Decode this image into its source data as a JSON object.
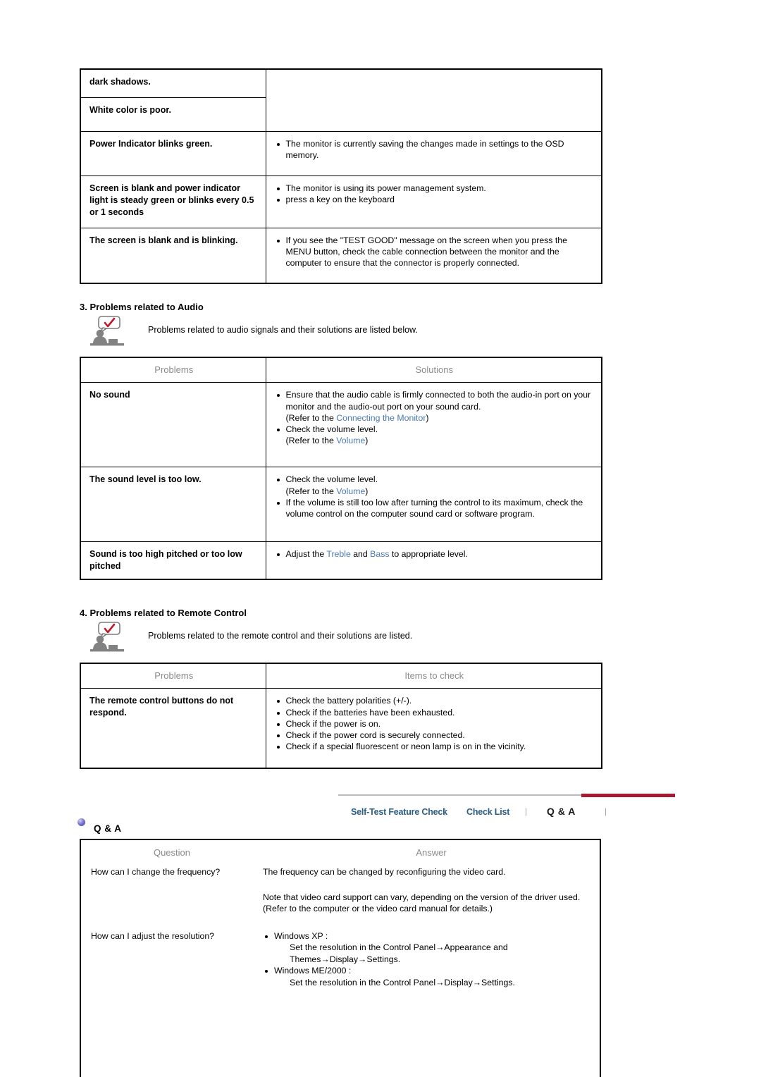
{
  "table_video": {
    "rows": [
      {
        "problem": "dark shadows.",
        "solutions": []
      },
      {
        "problem": "White color is poor.",
        "solutions": []
      },
      {
        "problem": "Power Indicator blinks green.",
        "solutions": [
          "The monitor is currently saving the changes made in settings to the OSD memory."
        ]
      },
      {
        "problem": "Screen is blank and power indicator light is steady green or blinks every 0.5 or 1 seconds",
        "solutions": [
          "The monitor is using its power management system.",
          "press a key on the keyboard"
        ]
      },
      {
        "problem": "The screen is blank and is blinking.",
        "solutions": [
          "If you see the \"TEST GOOD\" message on the screen when you press the MENU button, check the cable connection between the monitor and the computer to ensure that the connector is properly connected."
        ]
      }
    ]
  },
  "section_audio": {
    "heading": "3. Problems related to Audio",
    "note": "Problems related to audio signals and their solutions are listed below.",
    "headers": {
      "problems": "Problems",
      "solutions": "Solutions"
    },
    "rows": [
      {
        "problem": "No sound",
        "items": [
          "Ensure that the audio cable is firmly connected to both the audio-in port on your monitor and the audio-out port on your sound card.",
          "Check the volume level."
        ],
        "refs": {
          "connect_pre": "(Refer to the ",
          "connect_link": "Connecting the Monitor",
          "connect_post": ")",
          "vol_pre": "(Refer to the ",
          "vol_link": "Volume",
          "vol_post": ")"
        }
      },
      {
        "problem": "The sound level is too low.",
        "items": [
          "Check the volume level.",
          "If the volume is still too low after turning the control to its maximum, check the volume control on the computer sound card or software program."
        ],
        "refs": {
          "vol_pre": "(Refer to the ",
          "vol_link": "Volume",
          "vol_post": ")"
        }
      },
      {
        "problem": "Sound is too high pitched or too low pitched",
        "adjust": {
          "pre": "Adjust the ",
          "link1": "Treble",
          "mid": " and ",
          "link2": "Bass",
          "post": " to appropriate level."
        }
      }
    ]
  },
  "section_remote": {
    "heading": "4. Problems related to Remote Control",
    "note": "Problems related to the remote control and their solutions are listed.",
    "headers": {
      "problems": "Problems",
      "items": "Items to check"
    },
    "row": {
      "problem": "The remote control buttons do not respond.",
      "items": [
        "Check the battery polarities (+/-).",
        "Check if the batteries have been exhausted.",
        "Check if the power is on.",
        "Check if the power cord is securely connected.",
        "Check if a special fluorescent or neon lamp is on in the vicinity."
      ]
    }
  },
  "nav": {
    "tabs": [
      {
        "label": "Self-Test Feature Check",
        "active": false
      },
      {
        "label": "Check List",
        "active": false
      },
      {
        "label": "Q & A",
        "active": true
      }
    ],
    "separator": "|",
    "active_color": "#a61b33",
    "link_color": "#2a5d84"
  },
  "qa": {
    "title": "Q & A",
    "headers": {
      "question": "Question",
      "answer": "Answer"
    },
    "rows": [
      {
        "question": "How can I change the frequency?",
        "answer_1": "The frequency can be changed by reconfiguring the video card.",
        "answer_2": "Note that video card support can vary, depending on the version of the driver used. (Refer to the computer or the video card manual for details.)"
      },
      {
        "question": "How can I adjust the resolution?",
        "bullets": [
          {
            "label": "Windows XP :",
            "detail": "Set the resolution in the Control Panel→Appearance and Themes→Display→Settings."
          },
          {
            "label": "Windows ME/2000 :",
            "detail": "Set the resolution in the Control Panel→Display→Settings."
          }
        ]
      }
    ]
  },
  "colors": {
    "link": "#4a78b5",
    "header_text": "#8a8a8a",
    "accent_red": "#a61b33",
    "nav_link": "#2a5d84"
  },
  "icons": {
    "note": "person-speech-bubble-check-icon",
    "qa_bullet": "sphere-bullet-icon"
  }
}
